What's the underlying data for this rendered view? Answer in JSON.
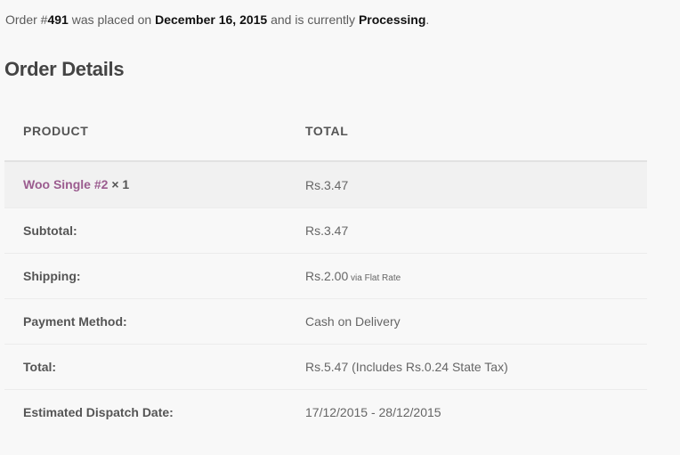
{
  "notice": {
    "p1": "Order #",
    "order_number": "491",
    "p2": " was placed on ",
    "date": "December 16, 2015",
    "p3": " and is currently ",
    "status": "Processing",
    "p4": "."
  },
  "heading": "Order Details",
  "table": {
    "col_product": "PRODUCT",
    "col_total": "TOTAL",
    "item": {
      "name": "Woo Single #2",
      "qty": " × 1",
      "total": "Rs.3.47"
    },
    "subtotal": {
      "label": "Subtotal:",
      "value": "Rs.3.47"
    },
    "shipping": {
      "label": "Shipping:",
      "value": "Rs.2.00",
      "via": " via Flat Rate"
    },
    "payment": {
      "label": "Payment Method:",
      "value": "Cash on Delivery"
    },
    "total": {
      "label": "Total:",
      "value": "Rs.5.47 (Includes Rs.0.24 State Tax)"
    },
    "dispatch": {
      "label": "Estimated Dispatch Date:",
      "value": "17/12/2015 - 28/12/2015"
    }
  }
}
